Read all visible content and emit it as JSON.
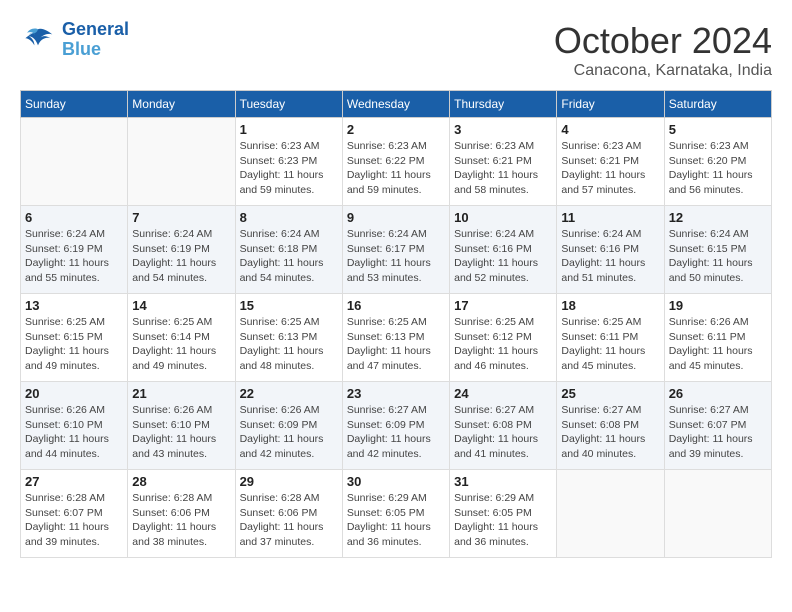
{
  "logo": {
    "line1": "General",
    "line2": "Blue"
  },
  "title": "October 2024",
  "subtitle": "Canacona, Karnataka, India",
  "headers": [
    "Sunday",
    "Monday",
    "Tuesday",
    "Wednesday",
    "Thursday",
    "Friday",
    "Saturday"
  ],
  "weeks": [
    [
      {
        "day": "",
        "info": ""
      },
      {
        "day": "",
        "info": ""
      },
      {
        "day": "1",
        "info": "Sunrise: 6:23 AM\nSunset: 6:23 PM\nDaylight: 11 hours and 59 minutes."
      },
      {
        "day": "2",
        "info": "Sunrise: 6:23 AM\nSunset: 6:22 PM\nDaylight: 11 hours and 59 minutes."
      },
      {
        "day": "3",
        "info": "Sunrise: 6:23 AM\nSunset: 6:21 PM\nDaylight: 11 hours and 58 minutes."
      },
      {
        "day": "4",
        "info": "Sunrise: 6:23 AM\nSunset: 6:21 PM\nDaylight: 11 hours and 57 minutes."
      },
      {
        "day": "5",
        "info": "Sunrise: 6:23 AM\nSunset: 6:20 PM\nDaylight: 11 hours and 56 minutes."
      }
    ],
    [
      {
        "day": "6",
        "info": "Sunrise: 6:24 AM\nSunset: 6:19 PM\nDaylight: 11 hours and 55 minutes."
      },
      {
        "day": "7",
        "info": "Sunrise: 6:24 AM\nSunset: 6:19 PM\nDaylight: 11 hours and 54 minutes."
      },
      {
        "day": "8",
        "info": "Sunrise: 6:24 AM\nSunset: 6:18 PM\nDaylight: 11 hours and 54 minutes."
      },
      {
        "day": "9",
        "info": "Sunrise: 6:24 AM\nSunset: 6:17 PM\nDaylight: 11 hours and 53 minutes."
      },
      {
        "day": "10",
        "info": "Sunrise: 6:24 AM\nSunset: 6:16 PM\nDaylight: 11 hours and 52 minutes."
      },
      {
        "day": "11",
        "info": "Sunrise: 6:24 AM\nSunset: 6:16 PM\nDaylight: 11 hours and 51 minutes."
      },
      {
        "day": "12",
        "info": "Sunrise: 6:24 AM\nSunset: 6:15 PM\nDaylight: 11 hours and 50 minutes."
      }
    ],
    [
      {
        "day": "13",
        "info": "Sunrise: 6:25 AM\nSunset: 6:15 PM\nDaylight: 11 hours and 49 minutes."
      },
      {
        "day": "14",
        "info": "Sunrise: 6:25 AM\nSunset: 6:14 PM\nDaylight: 11 hours and 49 minutes."
      },
      {
        "day": "15",
        "info": "Sunrise: 6:25 AM\nSunset: 6:13 PM\nDaylight: 11 hours and 48 minutes."
      },
      {
        "day": "16",
        "info": "Sunrise: 6:25 AM\nSunset: 6:13 PM\nDaylight: 11 hours and 47 minutes."
      },
      {
        "day": "17",
        "info": "Sunrise: 6:25 AM\nSunset: 6:12 PM\nDaylight: 11 hours and 46 minutes."
      },
      {
        "day": "18",
        "info": "Sunrise: 6:25 AM\nSunset: 6:11 PM\nDaylight: 11 hours and 45 minutes."
      },
      {
        "day": "19",
        "info": "Sunrise: 6:26 AM\nSunset: 6:11 PM\nDaylight: 11 hours and 45 minutes."
      }
    ],
    [
      {
        "day": "20",
        "info": "Sunrise: 6:26 AM\nSunset: 6:10 PM\nDaylight: 11 hours and 44 minutes."
      },
      {
        "day": "21",
        "info": "Sunrise: 6:26 AM\nSunset: 6:10 PM\nDaylight: 11 hours and 43 minutes."
      },
      {
        "day": "22",
        "info": "Sunrise: 6:26 AM\nSunset: 6:09 PM\nDaylight: 11 hours and 42 minutes."
      },
      {
        "day": "23",
        "info": "Sunrise: 6:27 AM\nSunset: 6:09 PM\nDaylight: 11 hours and 42 minutes."
      },
      {
        "day": "24",
        "info": "Sunrise: 6:27 AM\nSunset: 6:08 PM\nDaylight: 11 hours and 41 minutes."
      },
      {
        "day": "25",
        "info": "Sunrise: 6:27 AM\nSunset: 6:08 PM\nDaylight: 11 hours and 40 minutes."
      },
      {
        "day": "26",
        "info": "Sunrise: 6:27 AM\nSunset: 6:07 PM\nDaylight: 11 hours and 39 minutes."
      }
    ],
    [
      {
        "day": "27",
        "info": "Sunrise: 6:28 AM\nSunset: 6:07 PM\nDaylight: 11 hours and 39 minutes."
      },
      {
        "day": "28",
        "info": "Sunrise: 6:28 AM\nSunset: 6:06 PM\nDaylight: 11 hours and 38 minutes."
      },
      {
        "day": "29",
        "info": "Sunrise: 6:28 AM\nSunset: 6:06 PM\nDaylight: 11 hours and 37 minutes."
      },
      {
        "day": "30",
        "info": "Sunrise: 6:29 AM\nSunset: 6:05 PM\nDaylight: 11 hours and 36 minutes."
      },
      {
        "day": "31",
        "info": "Sunrise: 6:29 AM\nSunset: 6:05 PM\nDaylight: 11 hours and 36 minutes."
      },
      {
        "day": "",
        "info": ""
      },
      {
        "day": "",
        "info": ""
      }
    ]
  ]
}
